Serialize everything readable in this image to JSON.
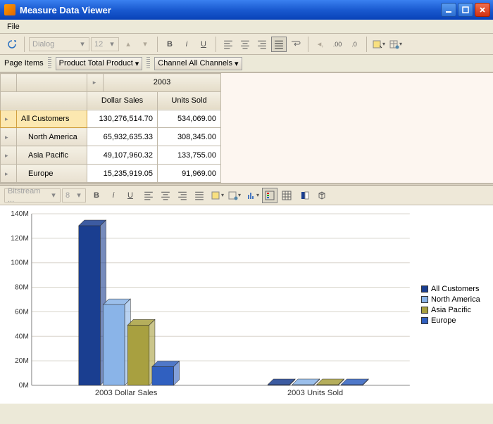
{
  "window": {
    "title": "Measure Data Viewer"
  },
  "menubar": {
    "items": [
      "File"
    ]
  },
  "toolbar1": {
    "font_family": "Dialog",
    "font_size": "12"
  },
  "pageitems": {
    "label": "Page Items",
    "product_label": "Product",
    "product_value": "Total Product",
    "channel_label": "Channel",
    "channel_value": "All Channels"
  },
  "grid": {
    "year": "2003",
    "cols": {
      "dollar": "Dollar Sales",
      "units": "Units Sold"
    },
    "rows": [
      {
        "label": "All Customers",
        "dollar": "130,276,514.70",
        "units": "534,069.00"
      },
      {
        "label": "North America",
        "dollar": "65,932,635.33",
        "units": "308,345.00"
      },
      {
        "label": "Asia Pacific",
        "dollar": "49,107,960.32",
        "units": "133,755.00"
      },
      {
        "label": "Europe",
        "dollar": "15,235,919.05",
        "units": "91,969.00"
      }
    ]
  },
  "toolbar2": {
    "font_family": "Bitstream ...",
    "font_size": "8"
  },
  "legend": {
    "items": [
      {
        "label": "All Customers",
        "color": "#1a3e90"
      },
      {
        "label": "North America",
        "color": "#8ab4e8"
      },
      {
        "label": "Asia Pacific",
        "color": "#a8a040"
      },
      {
        "label": "Europe",
        "color": "#3060c0"
      }
    ]
  },
  "chart_data": {
    "type": "bar",
    "title": "",
    "ylabel": "",
    "xlabel": "",
    "ylim": [
      0,
      140000000
    ],
    "y_ticks": [
      "0M",
      "20M",
      "40M",
      "60M",
      "80M",
      "100M",
      "120M",
      "140M"
    ],
    "categories": [
      "2003 Dollar Sales",
      "2003 Units Sold"
    ],
    "series": [
      {
        "name": "All Customers",
        "color": "#1a3e90",
        "values": [
          130276514.7,
          534069.0
        ]
      },
      {
        "name": "North America",
        "color": "#8ab4e8",
        "values": [
          65932635.33,
          308345.0
        ]
      },
      {
        "name": "Asia Pacific",
        "color": "#a8a040",
        "values": [
          49107960.32,
          133755.0
        ]
      },
      {
        "name": "Europe",
        "color": "#3060c0",
        "values": [
          15235919.05,
          91969.0
        ]
      }
    ]
  }
}
